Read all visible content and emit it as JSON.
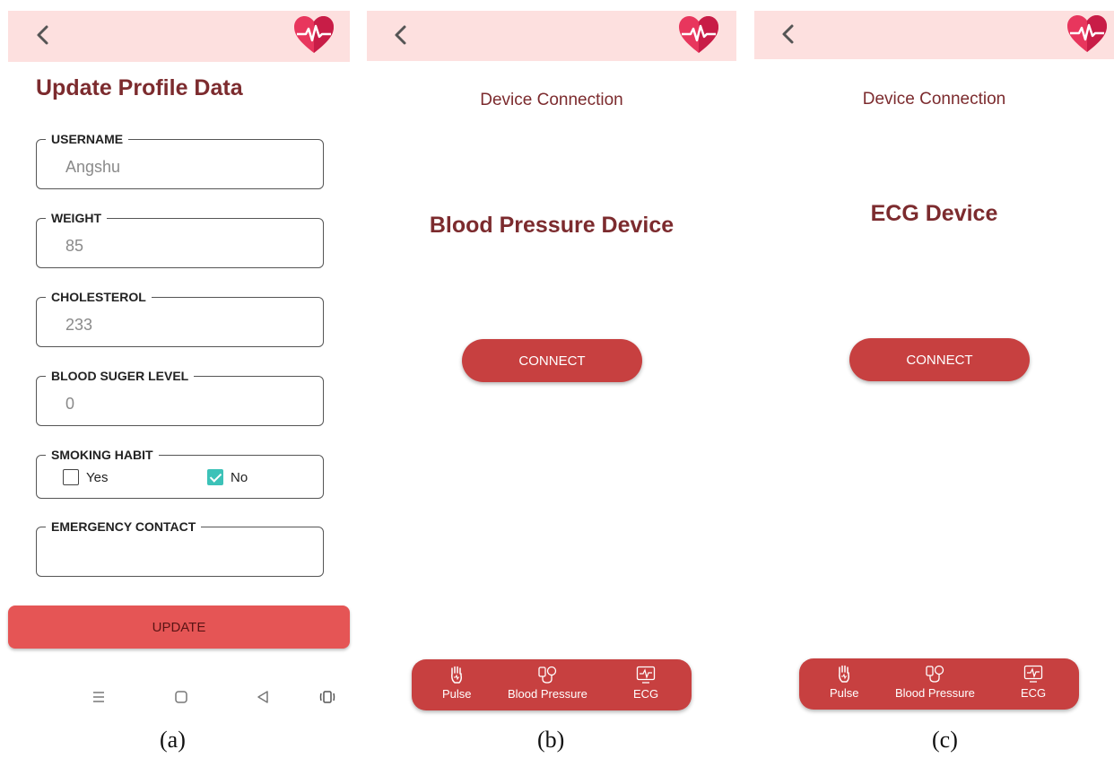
{
  "panel_a": {
    "title": "Update Profile Data",
    "fields": [
      {
        "label": "USERNAME",
        "value": "Angshu"
      },
      {
        "label": "WEIGHT",
        "value": "85"
      },
      {
        "label": "CHOLESTEROL",
        "value": "233"
      },
      {
        "label": "BLOOD SUGER LEVEL",
        "value": "0"
      }
    ],
    "smoking": {
      "label": "SMOKING HABIT",
      "yes_label": "Yes",
      "no_label": "No",
      "selected": "No"
    },
    "emergency": {
      "label": "EMERGENCY CONTACT",
      "value": ""
    },
    "update_label": "UPDATE",
    "system_nav_icons": [
      "menu-icon",
      "home-icon",
      "back-triangle-icon",
      "screen-rotate-icon"
    ],
    "caption": "(a)"
  },
  "panel_b": {
    "header": "Device Connection",
    "device_title": "Blood Pressure Device",
    "connect_label": "CONNECT",
    "nav": {
      "pulse": "Pulse",
      "bp": "Blood Pressure",
      "ecg": "ECG"
    },
    "caption": "(b)"
  },
  "panel_c": {
    "header": "Device Connection",
    "device_title": "ECG Device",
    "connect_label": "CONNECT",
    "nav": {
      "pulse": "Pulse",
      "bp": "Blood Pressure",
      "ecg": "ECG"
    },
    "caption": "(c)"
  },
  "colors": {
    "topbar": "#fde0df",
    "title_text": "#7c2b2e",
    "button": "#c74040",
    "update_button": "#e55555",
    "checkbox_checked": "#3cc2b8",
    "heart": "#e8365d"
  }
}
